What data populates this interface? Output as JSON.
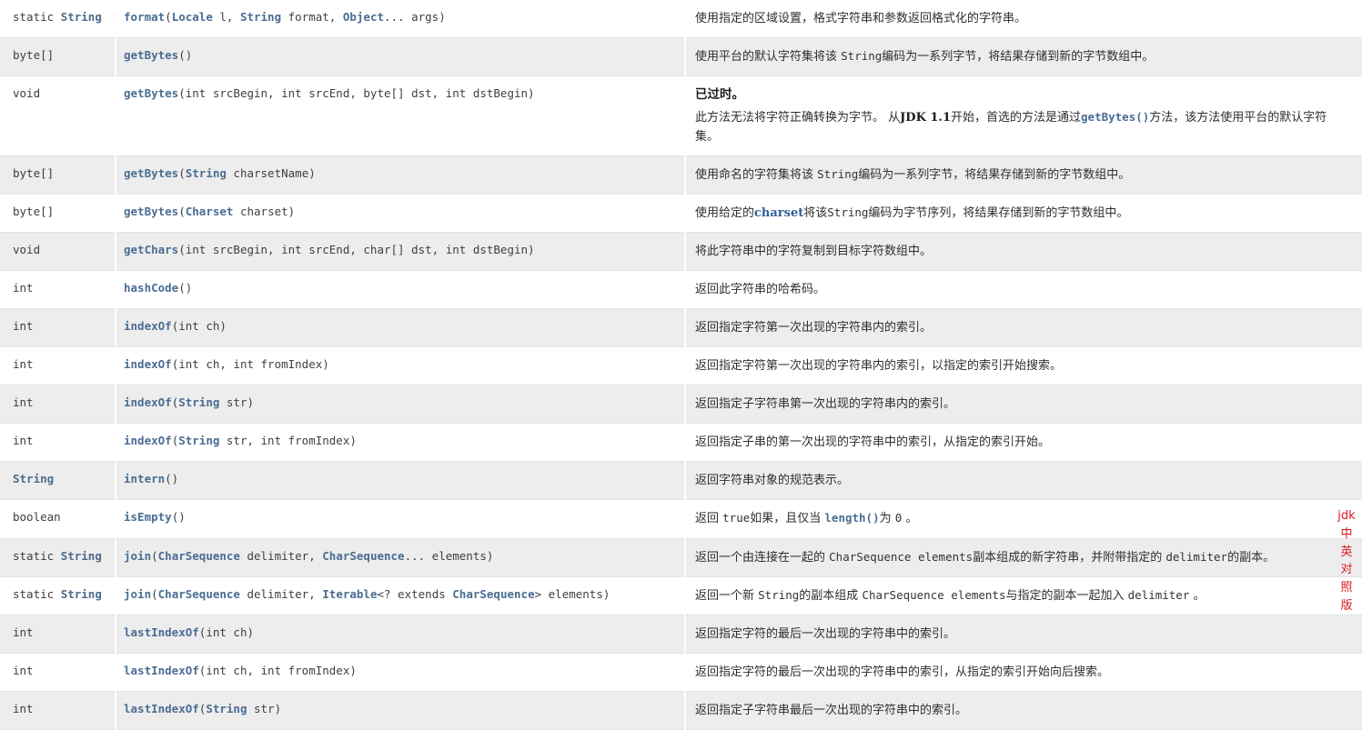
{
  "colors": {
    "link": "#4a6d93",
    "row_alt_bg": "#ededed",
    "row_bg": "#ffffff",
    "row_border": "#e3e3e3",
    "watermark": "#d71920",
    "text": "#2f2f2f"
  },
  "watermark": {
    "name": "jdk-chinese-english-watermark",
    "lines": [
      "jdk",
      "中",
      "英",
      "对",
      "照",
      "版"
    ]
  },
  "table": {
    "rows": [
      {
        "type_static": "static ",
        "type_link": "String",
        "type_plain": "",
        "sig_name": "format",
        "sig_parts": [
          {
            "t": "plain",
            "v": "("
          },
          {
            "t": "link",
            "v": "Locale"
          },
          {
            "t": "plain",
            "v": " l, "
          },
          {
            "t": "link",
            "v": "String"
          },
          {
            "t": "plain",
            "v": " format, "
          },
          {
            "t": "link",
            "v": "Object"
          },
          {
            "t": "plain",
            "v": "... args)"
          }
        ],
        "desc_parts": [
          {
            "t": "text",
            "v": "使用指定的区域设置，格式字符串和参数返回格式化的字符串。"
          }
        ],
        "shaded": false
      },
      {
        "type_static": "",
        "type_link": "",
        "type_plain": "byte[]",
        "sig_name": "getBytes",
        "sig_parts": [
          {
            "t": "plain",
            "v": "()"
          }
        ],
        "desc_parts": [
          {
            "t": "text",
            "v": "使用平台的默认字符集将该 "
          },
          {
            "t": "code",
            "v": "String"
          },
          {
            "t": "text",
            "v": "编码为一系列字节，将结果存储到新的字节数组中。"
          }
        ],
        "shaded": true
      },
      {
        "type_static": "",
        "type_link": "",
        "type_plain": "void",
        "sig_name": "getBytes",
        "sig_parts": [
          {
            "t": "plain",
            "v": "(int srcBegin, int srcEnd, byte[] dst, int dstBegin)"
          }
        ],
        "desc_parts": [
          {
            "t": "deprecated_title",
            "v": "已过时。"
          },
          {
            "t": "text",
            "v": "此方法无法将字符正确转换为字节。 从"
          },
          {
            "t": "serif_bold",
            "v": "JDK 1.1"
          },
          {
            "t": "text",
            "v": "开始，首选的方法是通过"
          },
          {
            "t": "code_link",
            "v": "getBytes()"
          },
          {
            "t": "text",
            "v": "方法，该方法使用平台的默认字符集。"
          }
        ],
        "shaded": false
      },
      {
        "type_static": "",
        "type_link": "",
        "type_plain": "byte[]",
        "sig_name": "getBytes",
        "sig_parts": [
          {
            "t": "plain",
            "v": "("
          },
          {
            "t": "link",
            "v": "String"
          },
          {
            "t": "plain",
            "v": " charsetName)"
          }
        ],
        "desc_parts": [
          {
            "t": "text",
            "v": "使用命名的字符集将该 "
          },
          {
            "t": "code",
            "v": "String"
          },
          {
            "t": "text",
            "v": "编码为一系列字节，将结果存储到新的字节数组中。"
          }
        ],
        "shaded": true
      },
      {
        "type_static": "",
        "type_link": "",
        "type_plain": "byte[]",
        "sig_name": "getBytes",
        "sig_parts": [
          {
            "t": "plain",
            "v": "("
          },
          {
            "t": "link",
            "v": "Charset"
          },
          {
            "t": "plain",
            "v": " charset)"
          }
        ],
        "desc_parts": [
          {
            "t": "text",
            "v": "使用给定的"
          },
          {
            "t": "serif_bold_link",
            "v": "charset"
          },
          {
            "t": "text",
            "v": "将该"
          },
          {
            "t": "code",
            "v": "String"
          },
          {
            "t": "text",
            "v": "编码为字节序列，将结果存储到新的字节数组中。"
          }
        ],
        "shaded": false
      },
      {
        "type_static": "",
        "type_link": "",
        "type_plain": "void",
        "sig_name": "getChars",
        "sig_parts": [
          {
            "t": "plain",
            "v": "(int srcBegin, int srcEnd, char[] dst, int dstBegin)"
          }
        ],
        "desc_parts": [
          {
            "t": "text",
            "v": "将此字符串中的字符复制到目标字符数组中。"
          }
        ],
        "shaded": true
      },
      {
        "type_static": "",
        "type_link": "",
        "type_plain": "int",
        "sig_name": "hashCode",
        "sig_parts": [
          {
            "t": "plain",
            "v": "()"
          }
        ],
        "desc_parts": [
          {
            "t": "text",
            "v": "返回此字符串的哈希码。"
          }
        ],
        "shaded": false
      },
      {
        "type_static": "",
        "type_link": "",
        "type_plain": "int",
        "sig_name": "indexOf",
        "sig_parts": [
          {
            "t": "plain",
            "v": "(int ch)"
          }
        ],
        "desc_parts": [
          {
            "t": "text",
            "v": "返回指定字符第一次出现的字符串内的索引。"
          }
        ],
        "shaded": true
      },
      {
        "type_static": "",
        "type_link": "",
        "type_plain": "int",
        "sig_name": "indexOf",
        "sig_parts": [
          {
            "t": "plain",
            "v": "(int ch, int fromIndex)"
          }
        ],
        "desc_parts": [
          {
            "t": "text",
            "v": "返回指定字符第一次出现的字符串内的索引，以指定的索引开始搜索。"
          }
        ],
        "shaded": false
      },
      {
        "type_static": "",
        "type_link": "",
        "type_plain": "int",
        "sig_name": "indexOf",
        "sig_parts": [
          {
            "t": "plain",
            "v": "("
          },
          {
            "t": "link",
            "v": "String"
          },
          {
            "t": "plain",
            "v": " str)"
          }
        ],
        "desc_parts": [
          {
            "t": "text",
            "v": "返回指定子字符串第一次出现的字符串内的索引。"
          }
        ],
        "shaded": true
      },
      {
        "type_static": "",
        "type_link": "",
        "type_plain": "int",
        "sig_name": "indexOf",
        "sig_parts": [
          {
            "t": "plain",
            "v": "("
          },
          {
            "t": "link",
            "v": "String"
          },
          {
            "t": "plain",
            "v": " str, int fromIndex)"
          }
        ],
        "desc_parts": [
          {
            "t": "text",
            "v": "返回指定子串的第一次出现的字符串中的索引，从指定的索引开始。"
          }
        ],
        "shaded": false
      },
      {
        "type_static": "",
        "type_link": "String",
        "type_plain": "",
        "sig_name": "intern",
        "sig_parts": [
          {
            "t": "plain",
            "v": "()"
          }
        ],
        "desc_parts": [
          {
            "t": "text",
            "v": "返回字符串对象的规范表示。"
          }
        ],
        "shaded": true
      },
      {
        "type_static": "",
        "type_link": "",
        "type_plain": "boolean",
        "sig_name": "isEmpty",
        "sig_parts": [
          {
            "t": "plain",
            "v": "()"
          }
        ],
        "desc_parts": [
          {
            "t": "text",
            "v": "返回 "
          },
          {
            "t": "code",
            "v": "true"
          },
          {
            "t": "text",
            "v": "如果，且仅当 "
          },
          {
            "t": "code_link",
            "v": "length()"
          },
          {
            "t": "text",
            "v": "为 "
          },
          {
            "t": "code",
            "v": "0"
          },
          {
            "t": "text",
            "v": " 。"
          }
        ],
        "shaded": false
      },
      {
        "type_static": "static ",
        "type_link": "String",
        "type_plain": "",
        "sig_name": "join",
        "sig_parts": [
          {
            "t": "plain",
            "v": "("
          },
          {
            "t": "link",
            "v": "CharSequence"
          },
          {
            "t": "plain",
            "v": " delimiter, "
          },
          {
            "t": "link",
            "v": "CharSequence"
          },
          {
            "t": "plain",
            "v": "... elements)"
          }
        ],
        "desc_parts": [
          {
            "t": "text",
            "v": "返回一个由连接在一起的 "
          },
          {
            "t": "code",
            "v": "CharSequence elements"
          },
          {
            "t": "text",
            "v": "副本组成的新字符串，并附带指定的 "
          },
          {
            "t": "code",
            "v": "delimiter"
          },
          {
            "t": "text",
            "v": "的副本。"
          }
        ],
        "shaded": true
      },
      {
        "type_static": "static ",
        "type_link": "String",
        "type_plain": "",
        "sig_name": "join",
        "sig_parts": [
          {
            "t": "plain",
            "v": "("
          },
          {
            "t": "link",
            "v": "CharSequence"
          },
          {
            "t": "plain",
            "v": " delimiter, "
          },
          {
            "t": "link",
            "v": "Iterable"
          },
          {
            "t": "plain",
            "v": "<? extends "
          },
          {
            "t": "link",
            "v": "CharSequence"
          },
          {
            "t": "plain",
            "v": "> elements)"
          }
        ],
        "desc_parts": [
          {
            "t": "text",
            "v": "返回一个新 "
          },
          {
            "t": "code",
            "v": "String"
          },
          {
            "t": "text",
            "v": "的副本组成 "
          },
          {
            "t": "code",
            "v": "CharSequence elements"
          },
          {
            "t": "text",
            "v": "与指定的副本一起加入 "
          },
          {
            "t": "code",
            "v": "delimiter"
          },
          {
            "t": "text",
            "v": " 。"
          }
        ],
        "shaded": false
      },
      {
        "type_static": "",
        "type_link": "",
        "type_plain": "int",
        "sig_name": "lastIndexOf",
        "sig_parts": [
          {
            "t": "plain",
            "v": "(int ch)"
          }
        ],
        "desc_parts": [
          {
            "t": "text",
            "v": "返回指定字符的最后一次出现的字符串中的索引。"
          }
        ],
        "shaded": true
      },
      {
        "type_static": "",
        "type_link": "",
        "type_plain": "int",
        "sig_name": "lastIndexOf",
        "sig_parts": [
          {
            "t": "plain",
            "v": "(int ch, int fromIndex)"
          }
        ],
        "desc_parts": [
          {
            "t": "text",
            "v": "返回指定字符的最后一次出现的字符串中的索引，从指定的索引开始向后搜索。"
          }
        ],
        "shaded": false
      },
      {
        "type_static": "",
        "type_link": "",
        "type_plain": "int",
        "sig_name": "lastIndexOf",
        "sig_parts": [
          {
            "t": "plain",
            "v": "("
          },
          {
            "t": "link",
            "v": "String"
          },
          {
            "t": "plain",
            "v": " str)"
          }
        ],
        "desc_parts": [
          {
            "t": "text",
            "v": "返回指定子字符串最后一次出现的字符串中的索引。"
          }
        ],
        "shaded": true
      }
    ]
  }
}
